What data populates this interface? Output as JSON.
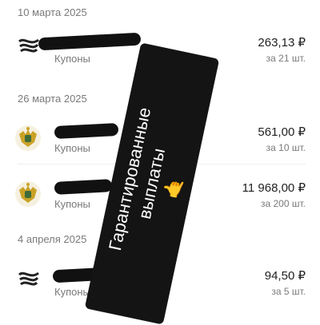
{
  "groups": [
    {
      "date": "10 марта 2025"
    },
    {
      "date": "26 марта 2025"
    },
    {
      "date": "4 апреля 2025"
    }
  ],
  "rows": [
    {
      "category": "Купоны",
      "amount": "263,13 ₽",
      "qty": "за 21 шт.",
      "icon": "scribbled-icon"
    },
    {
      "category": "Купоны",
      "amount": "561,00 ₽",
      "qty": "за 10 шт.",
      "icon": "russian-coat-of-arms-icon"
    },
    {
      "category": "Купоны",
      "amount": "11 968,00 ₽",
      "qty": "за 200 шт.",
      "icon": "russian-coat-of-arms-icon"
    },
    {
      "category": "Купоны",
      "amount": "94,50 ₽",
      "qty": "за 5 шт.",
      "icon": "scribbled-icon"
    }
  ],
  "banner": {
    "line1": "Гарантированные",
    "line2": "выплаты",
    "emoji": "🤙",
    "background": "#141414",
    "text_color": "#ffffff"
  },
  "colors": {
    "muted": "#7a7a7a",
    "text": "#1f1f1f",
    "emblem_gold": "#c9a227",
    "emblem_green": "#3f6b3a"
  }
}
